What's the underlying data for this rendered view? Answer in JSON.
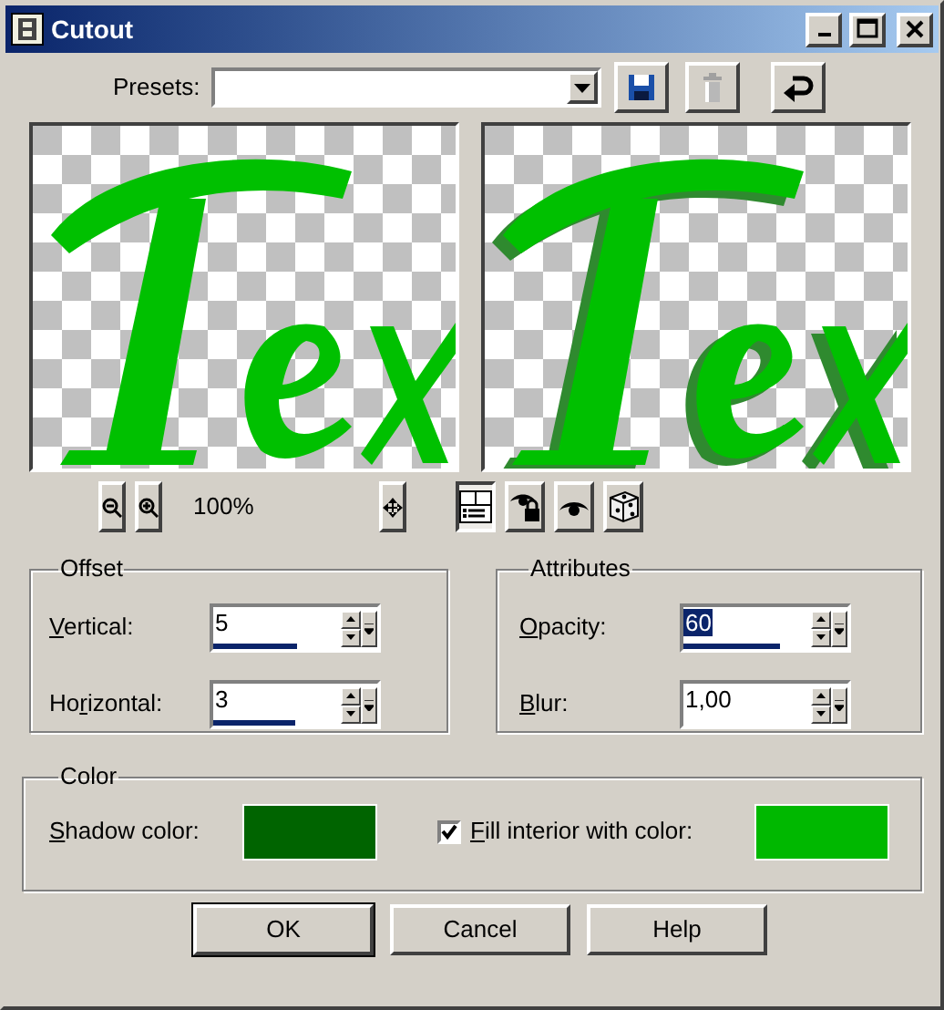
{
  "window": {
    "title": "Cutout"
  },
  "presets": {
    "label": "Presets:"
  },
  "preview": {
    "zoom_level": "100%"
  },
  "view_tools": [
    {
      "kind": "proof",
      "pressed": true
    },
    {
      "kind": "eye-lock",
      "pressed": false
    },
    {
      "kind": "eye",
      "pressed": false
    },
    {
      "kind": "dice",
      "pressed": false
    }
  ],
  "offset": {
    "title": "Offset",
    "fields": [
      {
        "mnemonic": "V",
        "after": "ertical:",
        "value": "5",
        "selected": false,
        "level": 0.52
      },
      {
        "before": "Ho",
        "mnemonic": "r",
        "after": "izontal:",
        "value": "3",
        "selected": false,
        "level": 0.51
      }
    ]
  },
  "attributes": {
    "title": "Attributes",
    "fields": [
      {
        "mnemonic": "O",
        "after": "pacity:",
        "value": "60",
        "selected": true,
        "level": 0.6
      },
      {
        "mnemonic": "B",
        "after": "lur:",
        "value": "1,00",
        "selected": false
      }
    ]
  },
  "color": {
    "title": "Color",
    "shadow": {
      "mnemonic": "S",
      "after": "hadow color:",
      "color": "#006400"
    },
    "fill": {
      "mnemonic": "F",
      "after": "ill interior with color:",
      "checked": true,
      "color": "#00b800"
    }
  },
  "buttons": [
    {
      "label": "OK",
      "default": true
    },
    {
      "label": "Cancel",
      "default": false
    },
    {
      "label": "Help",
      "default": false
    }
  ]
}
